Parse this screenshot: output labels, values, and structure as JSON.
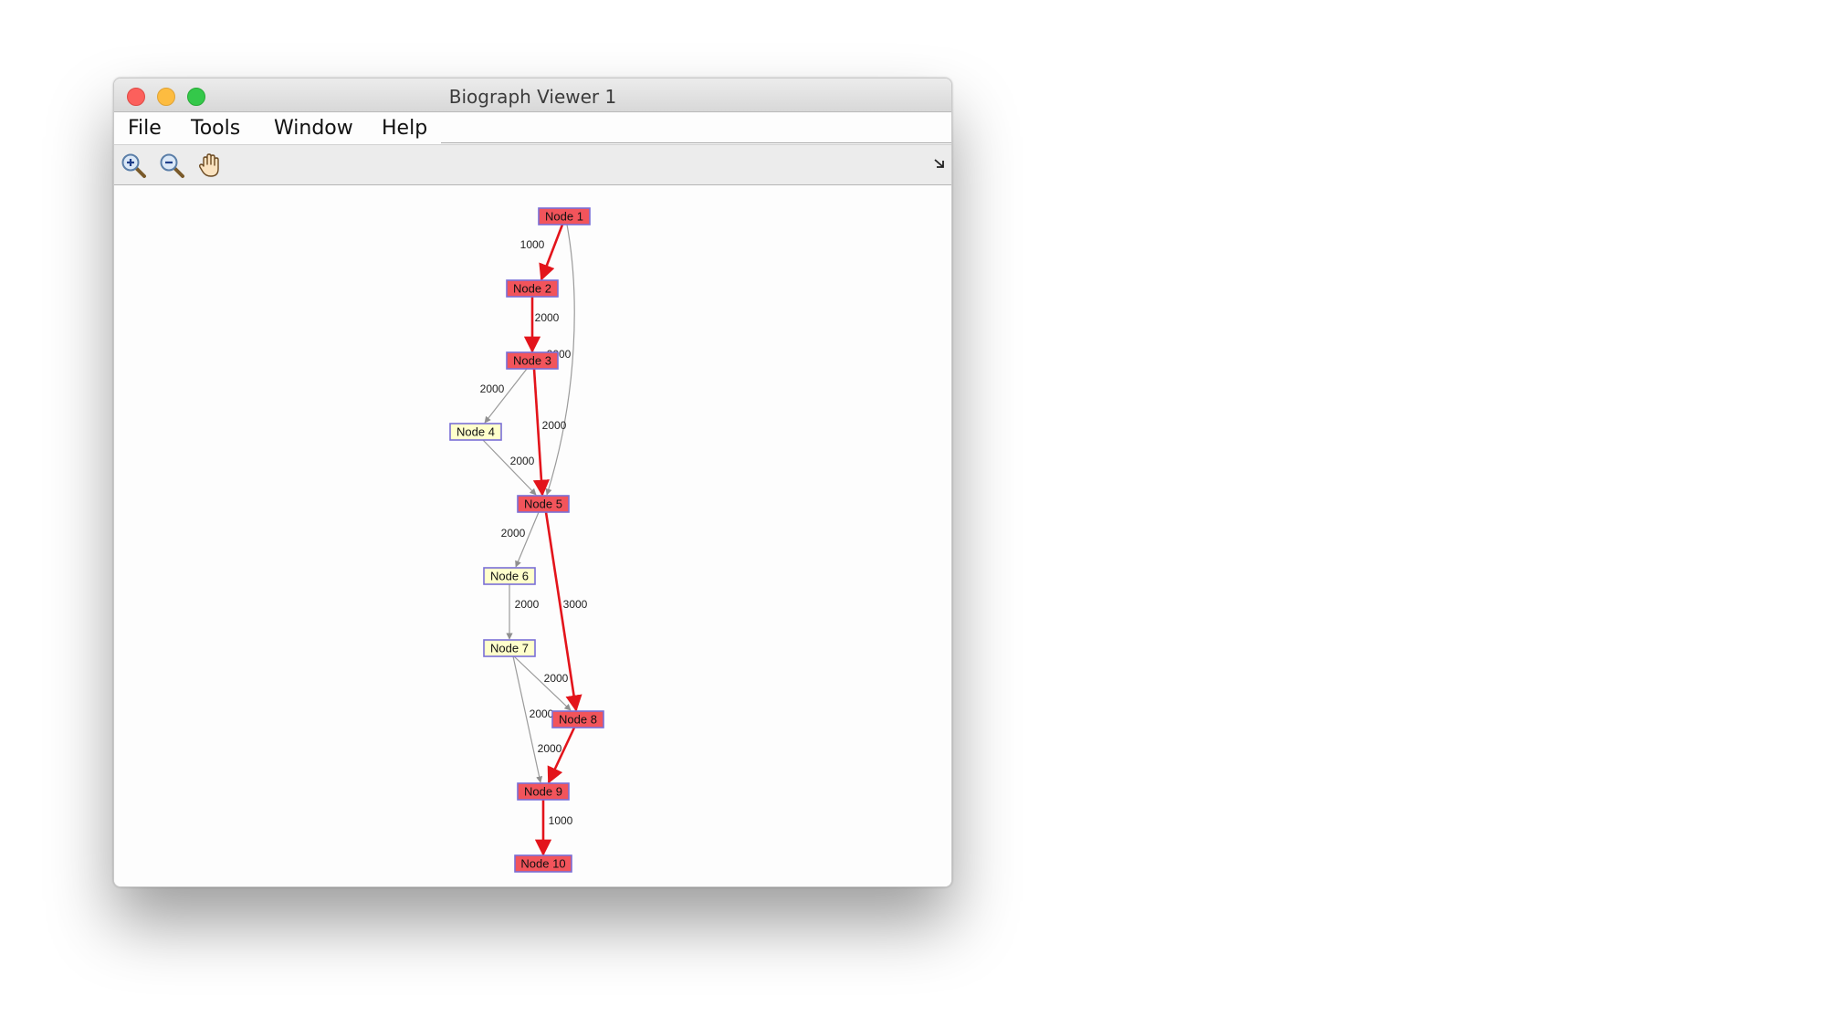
{
  "window": {
    "title": "Biograph Viewer 1"
  },
  "menu": [
    "File",
    "Tools",
    "Window",
    "Help"
  ],
  "toolbar": {
    "icons": [
      "zoom-in-icon",
      "zoom-out-icon",
      "hand-pan-icon"
    ],
    "corner_icon": "resize-arrow-icon"
  },
  "colors": {
    "highlight_node": "#f2545b",
    "normal_node": "#ffffcc",
    "node_border": "#7a6fd6",
    "highlight_edge": "#e3141b",
    "normal_edge": "#9a9a9a"
  },
  "graph": {
    "nodes": [
      {
        "id": "n1",
        "label": "Node 1",
        "highlighted": true
      },
      {
        "id": "n2",
        "label": "Node 2",
        "highlighted": true
      },
      {
        "id": "n3",
        "label": "Node 3",
        "highlighted": true
      },
      {
        "id": "n4",
        "label": "Node 4",
        "highlighted": false
      },
      {
        "id": "n5",
        "label": "Node 5",
        "highlighted": true
      },
      {
        "id": "n6",
        "label": "Node 6",
        "highlighted": false
      },
      {
        "id": "n7",
        "label": "Node 7",
        "highlighted": false
      },
      {
        "id": "n8",
        "label": "Node 8",
        "highlighted": true
      },
      {
        "id": "n9",
        "label": "Node 9",
        "highlighted": true
      },
      {
        "id": "n10",
        "label": "Node 10",
        "highlighted": true
      }
    ],
    "edges": [
      {
        "from": "n1",
        "to": "n2",
        "weight": "1000",
        "highlighted": true
      },
      {
        "from": "n1",
        "to": "n5",
        "weight": "2000",
        "highlighted": false
      },
      {
        "from": "n2",
        "to": "n3",
        "weight": "2000",
        "highlighted": true
      },
      {
        "from": "n3",
        "to": "n4",
        "weight": "2000",
        "highlighted": false
      },
      {
        "from": "n3",
        "to": "n5",
        "weight": "2000",
        "highlighted": true
      },
      {
        "from": "n4",
        "to": "n5",
        "weight": "2000",
        "highlighted": false
      },
      {
        "from": "n5",
        "to": "n6",
        "weight": "2000",
        "highlighted": false
      },
      {
        "from": "n5",
        "to": "n8",
        "weight": "3000",
        "highlighted": true
      },
      {
        "from": "n6",
        "to": "n7",
        "weight": "2000",
        "highlighted": false
      },
      {
        "from": "n7",
        "to": "n8",
        "weight": "2000",
        "highlighted": false
      },
      {
        "from": "n7",
        "to": "n9",
        "weight": "2000",
        "highlighted": false
      },
      {
        "from": "n8",
        "to": "n9",
        "weight": "2000",
        "highlighted": true
      },
      {
        "from": "n9",
        "to": "n10",
        "weight": "1000",
        "highlighted": true
      }
    ]
  }
}
